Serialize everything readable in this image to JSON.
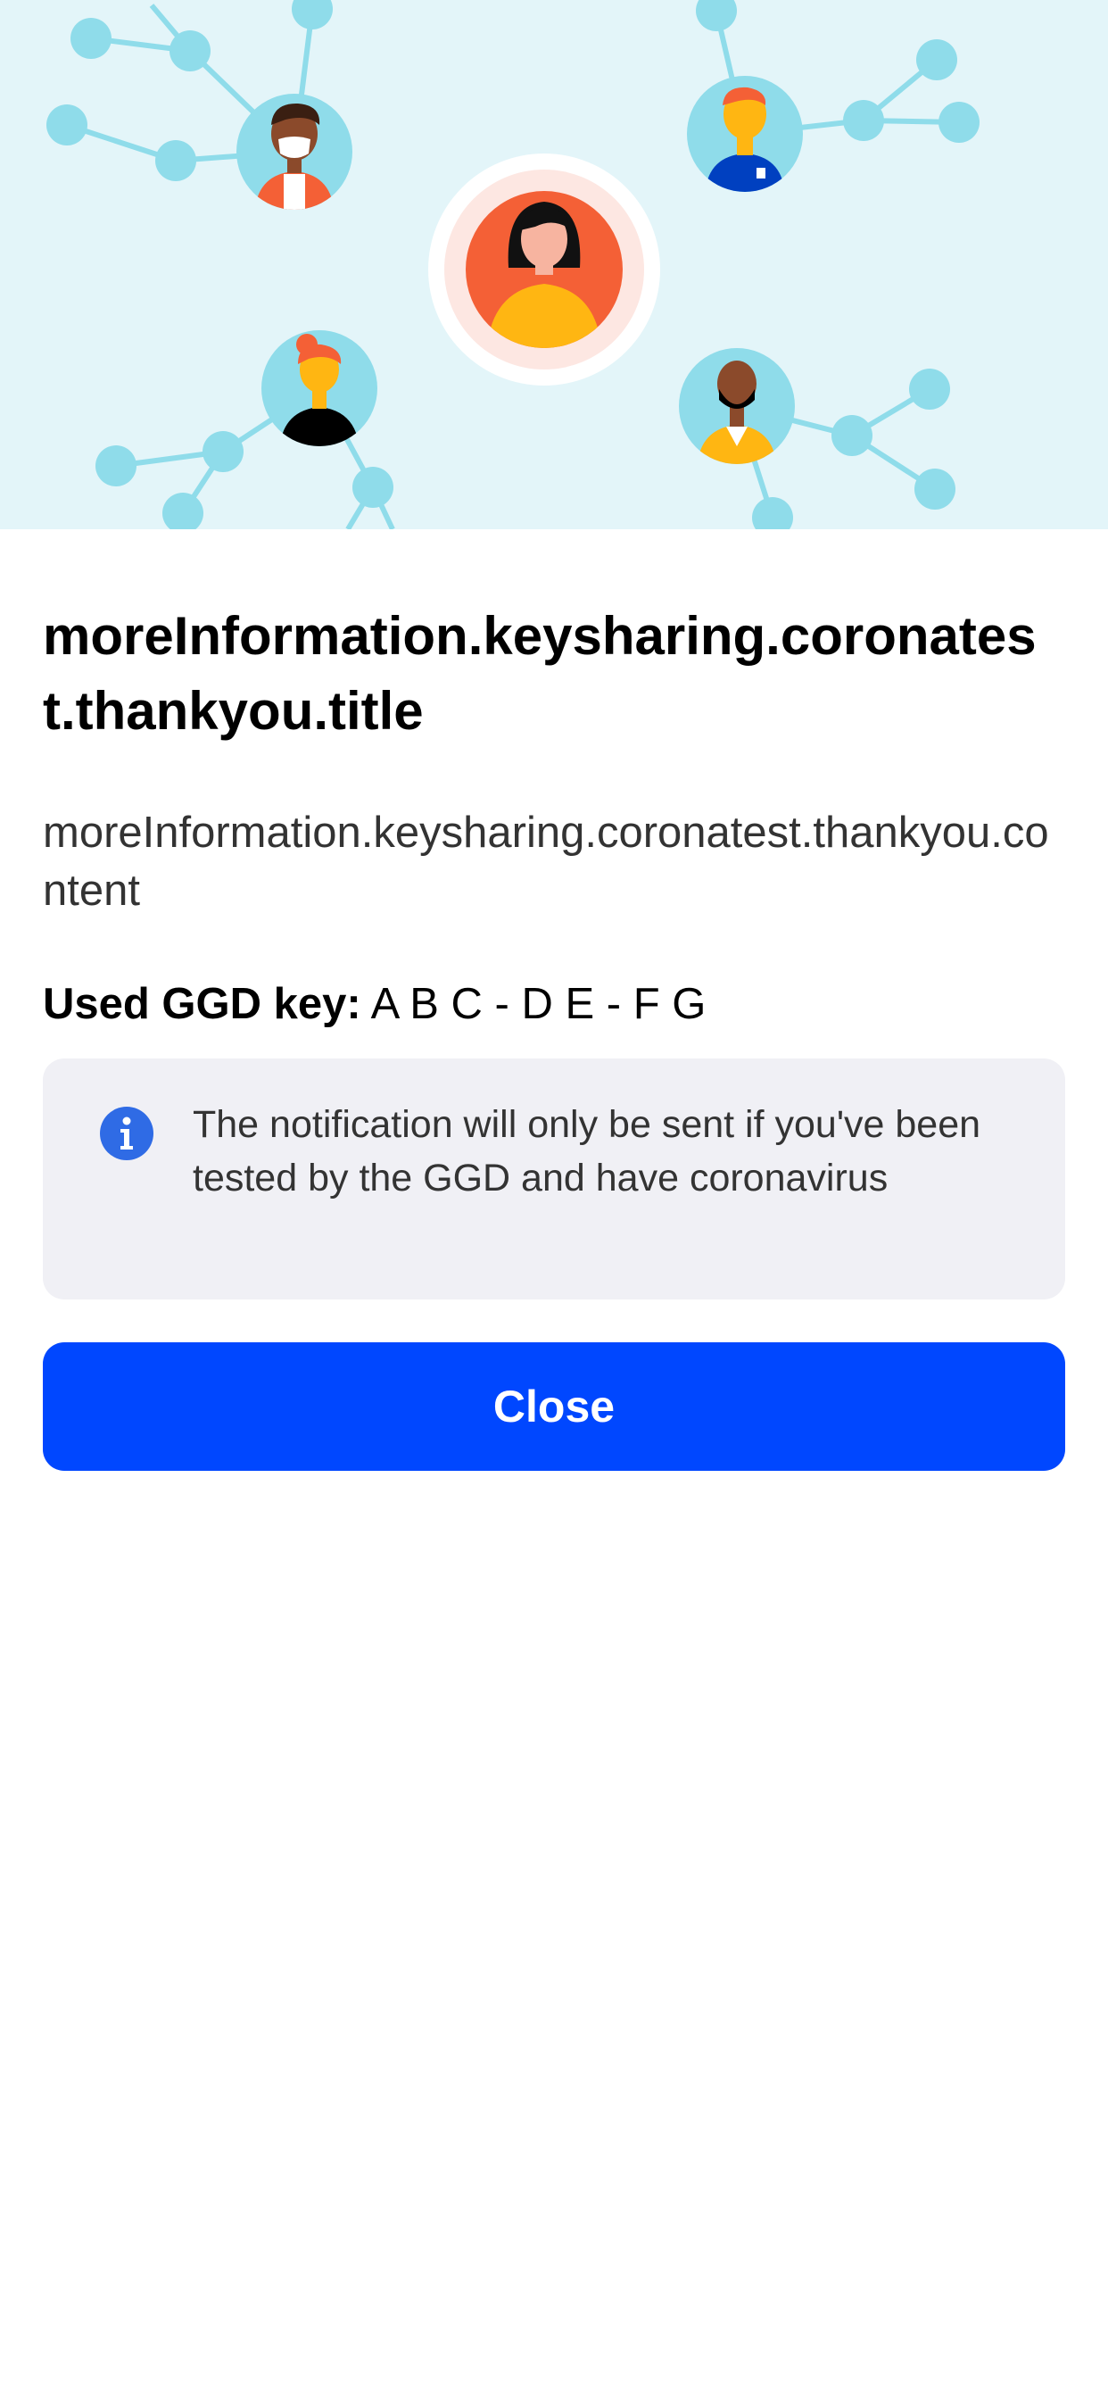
{
  "hero": {
    "illustration_icon": "contact-network-illustration",
    "colors": {
      "background": "#e3f5f9",
      "nodes": "#8fdcea",
      "center_avatar": "#f46036",
      "accent_yellow": "#ffb612",
      "accent_blue": "#0040c0"
    }
  },
  "title": "moreInformation.keysharing.coronatest.thankyou.title",
  "content": "moreInformation.keysharing.coronatest.thankyou.content",
  "key": {
    "label": "Used GGD key:",
    "value": "A B C - D E - F G"
  },
  "info": {
    "icon": "info-icon",
    "text": "The notification will only be sent if you've been tested by the GGD and have coronavirus"
  },
  "close_button": {
    "label": "Close",
    "color": "#0047ff"
  }
}
